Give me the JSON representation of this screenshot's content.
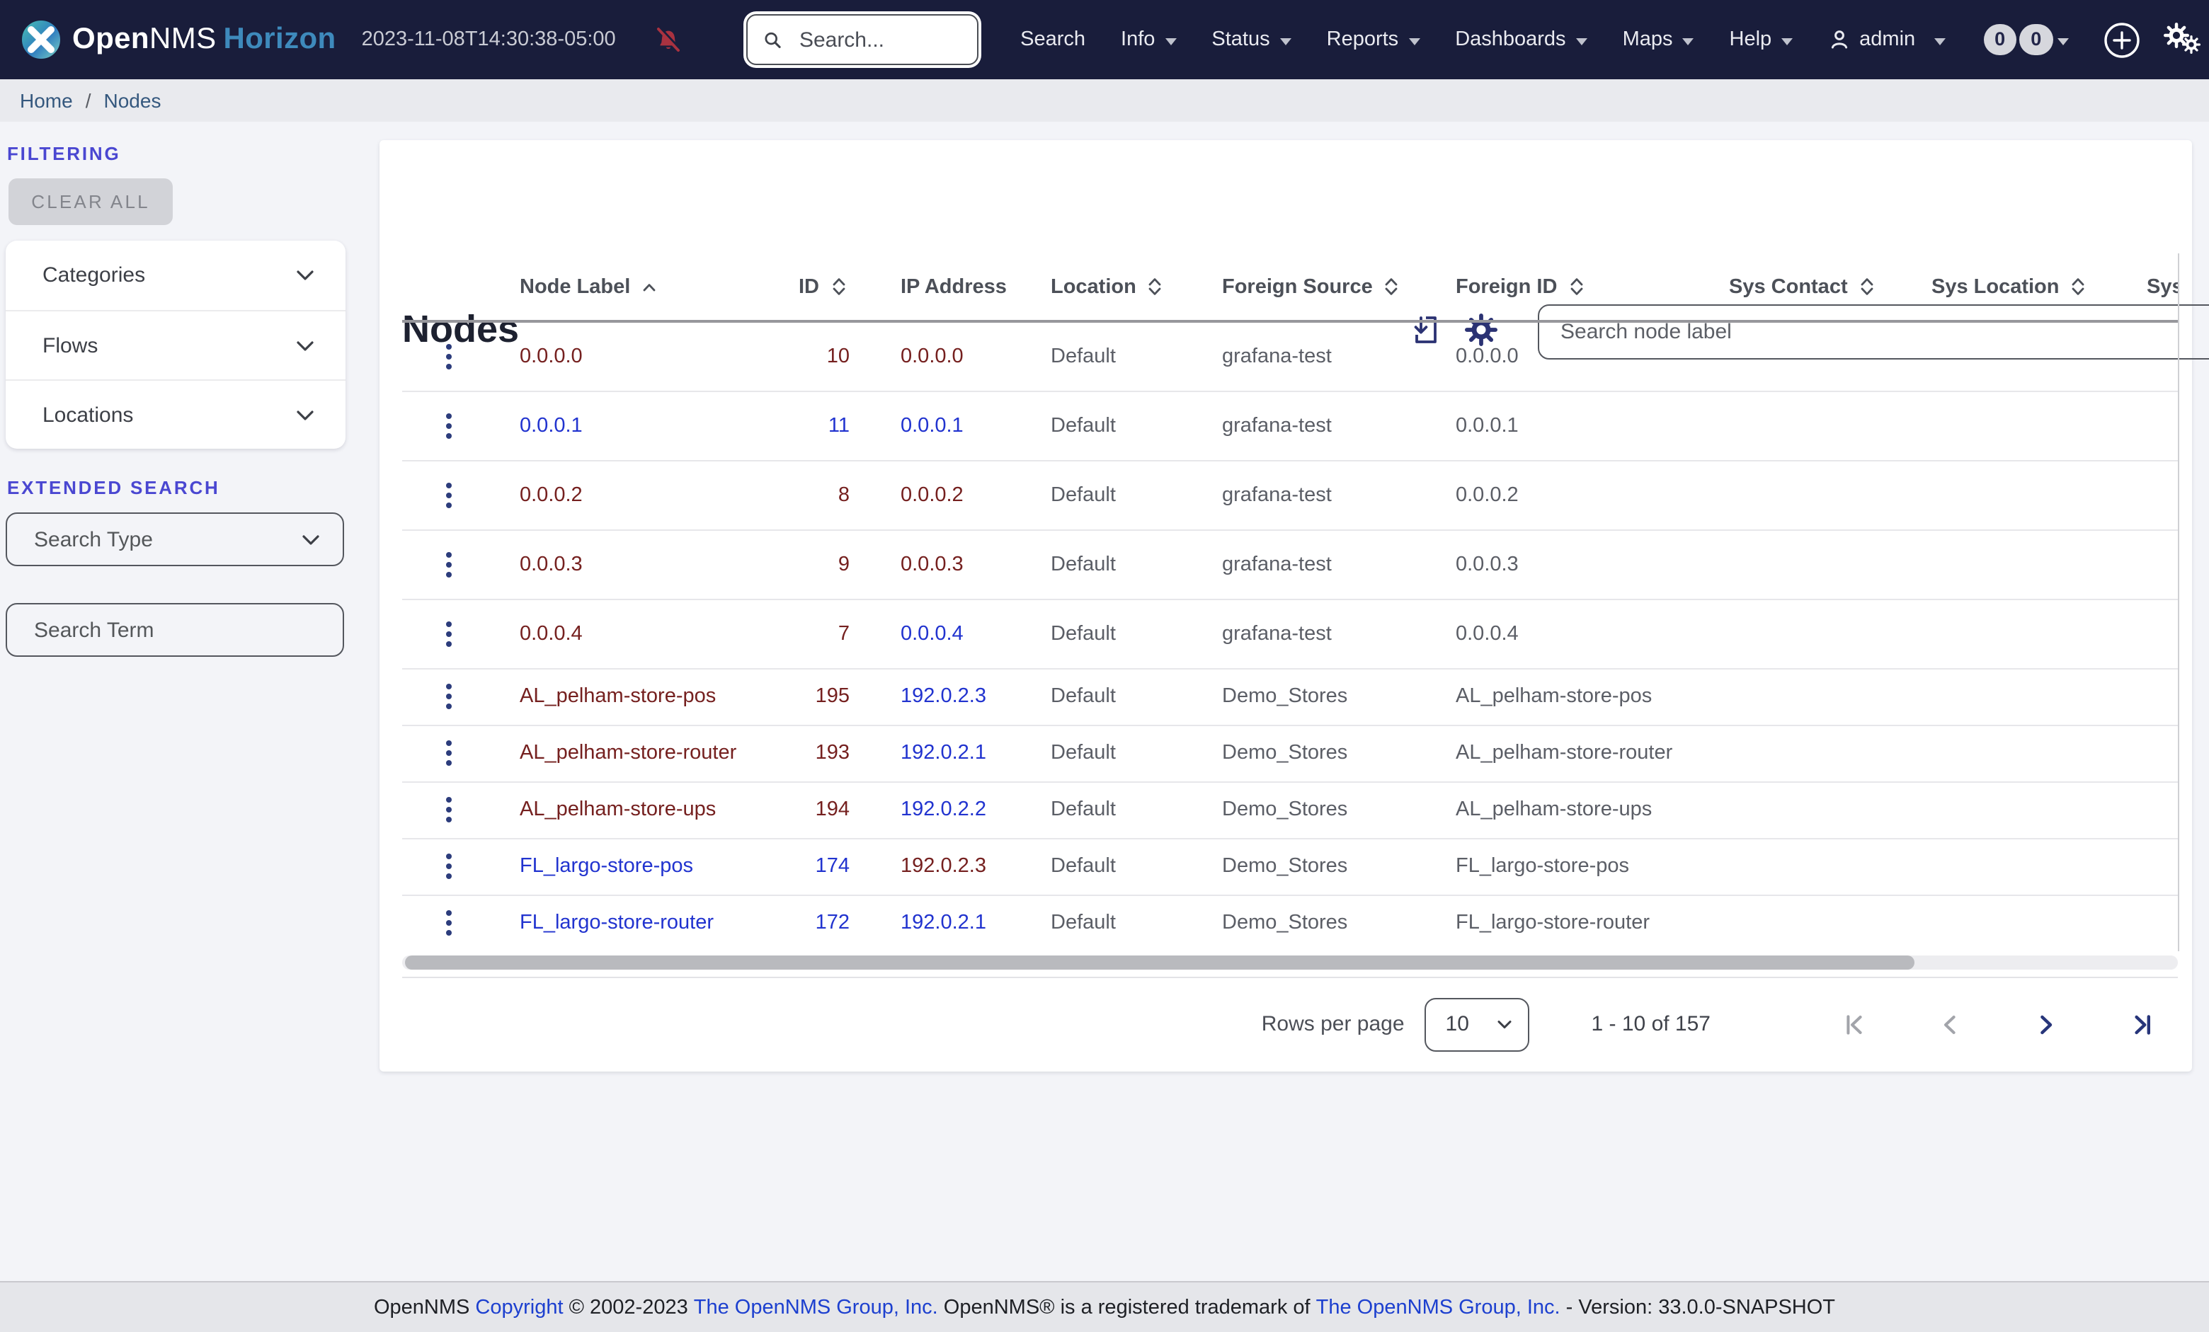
{
  "colors": {
    "navbar_bg": "#191d3b",
    "brand_product_blue": "#3e8abc",
    "accent_indigo": "#4a47d1",
    "link_maroon": "#75201f",
    "link_blue": "#2133cf",
    "icon_navy": "#2b3273",
    "footer_link_blue": "#1d40cf",
    "alert_red": "#a93240"
  },
  "navbar": {
    "brand": {
      "open": "Open",
      "nms": "NMS",
      "product": "Horizon"
    },
    "timestamp": "2023-11-08T14:30:38-05:00",
    "search_placeholder": "Search...",
    "menu": [
      {
        "label": "Search",
        "caret": false
      },
      {
        "label": "Info",
        "caret": true
      },
      {
        "label": "Status",
        "caret": true
      },
      {
        "label": "Reports",
        "caret": true
      },
      {
        "label": "Dashboards",
        "caret": true
      },
      {
        "label": "Maps",
        "caret": true
      },
      {
        "label": "Help",
        "caret": true
      }
    ],
    "user": {
      "label": "admin"
    },
    "badges": [
      "0",
      "0"
    ]
  },
  "breadcrumb": {
    "items": [
      "Home",
      "Nodes"
    ],
    "separator": "/"
  },
  "sidebar": {
    "filtering_label": "FILTERING",
    "clear_all_label": "CLEAR ALL",
    "accordions": [
      "Categories",
      "Flows",
      "Locations"
    ],
    "extended_search_label": "EXTENDED SEARCH",
    "search_type_label": "Search Type",
    "search_term_placeholder": "Search Term"
  },
  "main": {
    "title": "Nodes",
    "search_placeholder": "Search node label",
    "table": {
      "columns": [
        {
          "label": "Node Label",
          "sort": "asc"
        },
        {
          "label": "ID",
          "sort": "both"
        },
        {
          "label": "IP Address",
          "sort": "none"
        },
        {
          "label": "Location",
          "sort": "both"
        },
        {
          "label": "Foreign Source",
          "sort": "both"
        },
        {
          "label": "Foreign ID",
          "sort": "both"
        },
        {
          "label": "Sys Contact",
          "sort": "both"
        },
        {
          "label": "Sys Location",
          "sort": "both"
        },
        {
          "label": "Sys D",
          "sort": "none"
        }
      ],
      "rows": [
        {
          "label": "0.0.0.0",
          "label_color": "maroon",
          "id": "10",
          "id_color": "maroon",
          "ip": "0.0.0.0",
          "ip_color": "maroon",
          "location": "Default",
          "foreign_source": "grafana-test",
          "foreign_id": "0.0.0.0",
          "sys_contact": "",
          "sys_location": "",
          "sys_description": ""
        },
        {
          "label": "0.0.0.1",
          "label_color": "blue",
          "id": "11",
          "id_color": "blue",
          "ip": "0.0.0.1",
          "ip_color": "blue",
          "location": "Default",
          "foreign_source": "grafana-test",
          "foreign_id": "0.0.0.1",
          "sys_contact": "",
          "sys_location": "",
          "sys_description": ""
        },
        {
          "label": "0.0.0.2",
          "label_color": "maroon",
          "id": "8",
          "id_color": "maroon",
          "ip": "0.0.0.2",
          "ip_color": "maroon",
          "location": "Default",
          "foreign_source": "grafana-test",
          "foreign_id": "0.0.0.2",
          "sys_contact": "",
          "sys_location": "",
          "sys_description": ""
        },
        {
          "label": "0.0.0.3",
          "label_color": "maroon",
          "id": "9",
          "id_color": "maroon",
          "ip": "0.0.0.3",
          "ip_color": "maroon",
          "location": "Default",
          "foreign_source": "grafana-test",
          "foreign_id": "0.0.0.3",
          "sys_contact": "",
          "sys_location": "",
          "sys_description": ""
        },
        {
          "label": "0.0.0.4",
          "label_color": "maroon",
          "id": "7",
          "id_color": "maroon",
          "ip": "0.0.0.4",
          "ip_color": "blue",
          "location": "Default",
          "foreign_source": "grafana-test",
          "foreign_id": "0.0.0.4",
          "sys_contact": "",
          "sys_location": "",
          "sys_description": ""
        },
        {
          "label": "AL_pelham-store-pos",
          "label_color": "maroon",
          "id": "195",
          "id_color": "maroon",
          "ip": "192.0.2.3",
          "ip_color": "blue",
          "location": "Default",
          "foreign_source": "Demo_Stores",
          "foreign_id": "AL_pelham-store-pos",
          "sys_contact": "",
          "sys_location": "",
          "sys_description": ""
        },
        {
          "label": "AL_pelham-store-router",
          "label_color": "maroon",
          "id": "193",
          "id_color": "maroon",
          "ip": "192.0.2.1",
          "ip_color": "blue",
          "location": "Default",
          "foreign_source": "Demo_Stores",
          "foreign_id": "AL_pelham-store-router",
          "sys_contact": "",
          "sys_location": "",
          "sys_description": ""
        },
        {
          "label": "AL_pelham-store-ups",
          "label_color": "maroon",
          "id": "194",
          "id_color": "maroon",
          "ip": "192.0.2.2",
          "ip_color": "blue",
          "location": "Default",
          "foreign_source": "Demo_Stores",
          "foreign_id": "AL_pelham-store-ups",
          "sys_contact": "",
          "sys_location": "",
          "sys_description": ""
        },
        {
          "label": "FL_largo-store-pos",
          "label_color": "blue",
          "id": "174",
          "id_color": "blue",
          "ip": "192.0.2.3",
          "ip_color": "maroon",
          "location": "Default",
          "foreign_source": "Demo_Stores",
          "foreign_id": "FL_largo-store-pos",
          "sys_contact": "",
          "sys_location": "",
          "sys_description": ""
        },
        {
          "label": "FL_largo-store-router",
          "label_color": "blue",
          "id": "172",
          "id_color": "blue",
          "ip": "192.0.2.1",
          "ip_color": "blue",
          "location": "Default",
          "foreign_source": "Demo_Stores",
          "foreign_id": "FL_largo-store-router",
          "sys_contact": "",
          "sys_location": "",
          "sys_description": ""
        }
      ]
    },
    "pagination": {
      "rows_per_page_label": "Rows per page",
      "rows_per_page_value": "10",
      "range_label": "1 - 10 of 157"
    }
  },
  "footer": {
    "segments": [
      {
        "text": "OpenNMS ",
        "link": false
      },
      {
        "text": "Copyright",
        "link": true
      },
      {
        "text": " © 2002-2023 ",
        "link": false
      },
      {
        "text": "The OpenNMS Group, Inc.",
        "link": true
      },
      {
        "text": " OpenNMS® is a registered trademark of ",
        "link": false
      },
      {
        "text": "The OpenNMS Group, Inc.",
        "link": true
      },
      {
        "text": " - Version: 33.0.0-SNAPSHOT",
        "link": false
      }
    ]
  }
}
